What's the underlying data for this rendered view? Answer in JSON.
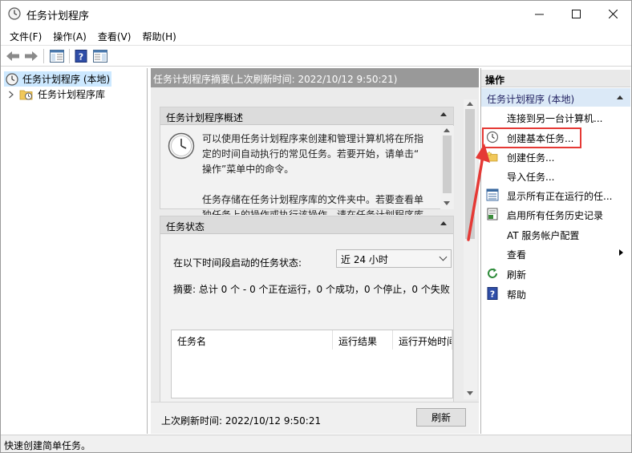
{
  "window": {
    "title": "任务计划程序"
  },
  "menu": [
    "文件(F)",
    "操作(A)",
    "查看(V)",
    "帮助(H)"
  ],
  "tree": {
    "root": "任务计划程序 (本地)",
    "child": "任务计划程序库"
  },
  "middle": {
    "header": "任务计划程序摘要(上次刷新时间: 2022/10/12 9:50:21)",
    "overview": {
      "title": "任务计划程序概述",
      "lines": [
        "可以使用任务计划程序来创建和管理计算机将在所指",
        "定的时间自动执行的常见任务。若要开始，请单击“",
        "操作”菜单中的命令。",
        "",
        "任务存储在任务计划程序库的文件夹中。若要查看单",
        "独任务上的操作或执行该操作，请在任务计划程序库"
      ]
    },
    "status": {
      "title": "任务状态",
      "filter_label": "在以下时间段启动的任务状态:",
      "filter_value": "近 24 小时",
      "summary": "摘要: 总计 0 个 - 0 个正在运行，0 个成功，0 个停止，0 个失败",
      "columns": [
        "任务名",
        "运行结果",
        "运行开始时间"
      ]
    },
    "last_refresh": "上次刷新时间: 2022/10/12 9:50:21",
    "refresh_label": "刷新"
  },
  "actions": {
    "header": "操作",
    "group": "任务计划程序 (本地)",
    "items": [
      {
        "label": "连接到另一台计算机...",
        "icon": "none"
      },
      {
        "label": "创建基本任务...",
        "icon": "clock-icon"
      },
      {
        "label": "创建任务...",
        "icon": "folder-star-icon"
      },
      {
        "label": "导入任务...",
        "icon": "none"
      },
      {
        "label": "显示所有正在运行的任...",
        "icon": "list-icon"
      },
      {
        "label": "启用所有任务历史记录",
        "icon": "history-icon"
      },
      {
        "label": "AT 服务帐户配置",
        "icon": "none"
      },
      {
        "label": "查看",
        "icon": "none"
      },
      {
        "label": "刷新",
        "icon": "refresh-icon"
      },
      {
        "label": "帮助",
        "icon": "help-icon"
      }
    ]
  },
  "statusbar": "快速创建简单任务。",
  "colors": {
    "accent_highlight": "#e53935",
    "group_bg": "#dbe9f7",
    "header_gray": "#999999"
  }
}
